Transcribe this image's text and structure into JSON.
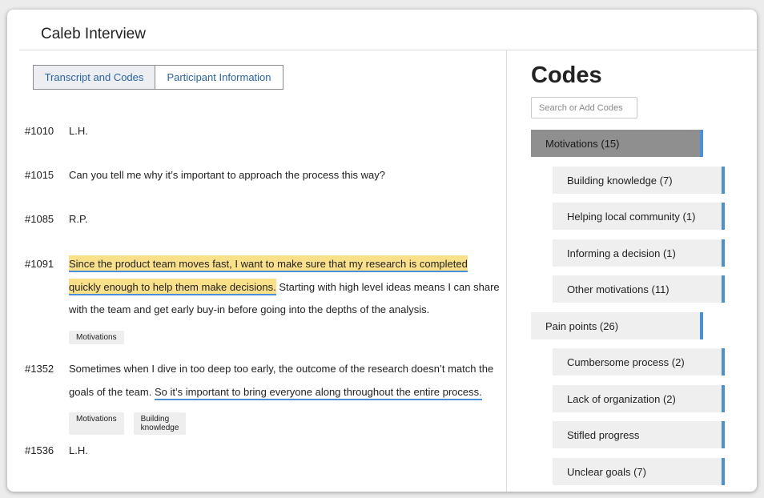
{
  "window": {
    "title": "Caleb Interview"
  },
  "tabs": [
    {
      "label": "Transcript and Codes",
      "active": true
    },
    {
      "label": "Participant Information",
      "active": false
    }
  ],
  "transcript": [
    {
      "id": "#1010",
      "text": "L.H."
    },
    {
      "id": "#1015",
      "text": "Can you tell me why it’s important to approach the process this way?"
    },
    {
      "id": "#1085",
      "text": "R.P."
    },
    {
      "id": "#1091",
      "highlighted": "Since the product team moves fast, I want to make sure that my research is completed quickly enough to help them make decisions.",
      "rest": " Starting with high level ideas means I can share with the team and get early buy-in before going into the depths of the analysis.",
      "tags": [
        "Motivations"
      ]
    },
    {
      "id": "#1352",
      "lead": "Sometimes when I dive in too deep too early, the outcome of the research doesn’t match the goals of the team. ",
      "underlined": "So it’s important to bring everyone along throughout the entire process.",
      "tags": [
        "Motivations",
        "Building knowledge"
      ]
    },
    {
      "id": "#1536",
      "text": "L.H."
    }
  ],
  "codes": {
    "heading": "Codes",
    "search_placeholder": "Search or Add Codes",
    "accent_color": "#4a90d9",
    "groups": [
      {
        "label": "Motivations (15)",
        "selected": true,
        "children": [
          "Building knowledge (7)",
          "Helping local community (1)",
          "Informing a decision (1)",
          "Other motivations (11)"
        ]
      },
      {
        "label": "Pain points (26)",
        "selected": false,
        "children": [
          "Cumbersome process (2)",
          "Lack of organization (2)",
          "Stifled progress",
          "Unclear goals (7)"
        ]
      }
    ]
  }
}
